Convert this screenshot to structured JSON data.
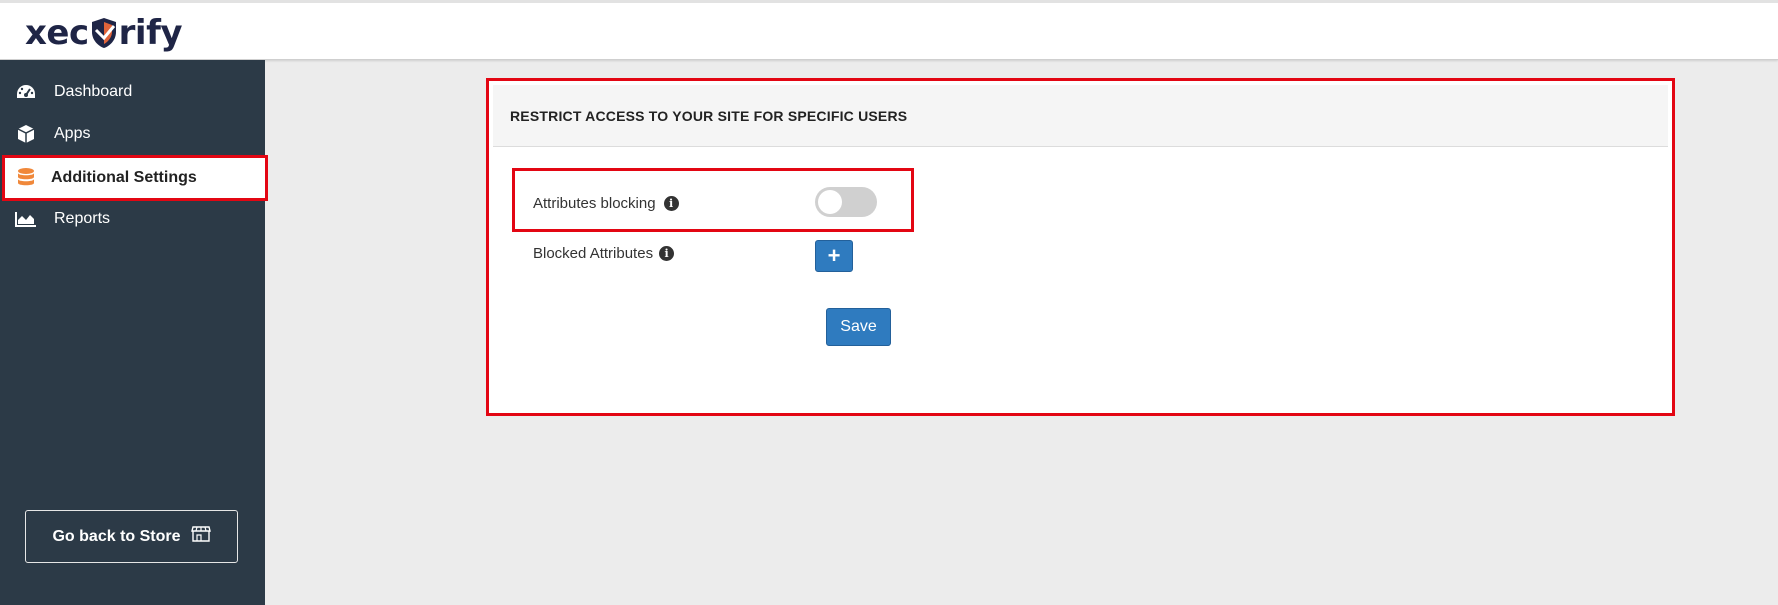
{
  "brand": {
    "logo_left": "xec",
    "logo_right": "rify"
  },
  "sidebar": {
    "items": [
      {
        "label": "Dashboard",
        "icon": "speedometer-icon"
      },
      {
        "label": "Apps",
        "icon": "cube-icon"
      },
      {
        "label": "Additional Settings",
        "icon": "database-icon",
        "active": true
      },
      {
        "label": "Reports",
        "icon": "area-chart-icon"
      }
    ],
    "store_button": "Go back to Store"
  },
  "panel": {
    "title": "RESTRICT ACCESS TO YOUR SITE FOR SPECIFIC USERS",
    "attributes_blocking_label": "Attributes blocking",
    "attributes_blocking_enabled": false,
    "blocked_attributes_label": "Blocked Attributes",
    "add_symbol": "+",
    "save_label": "Save"
  },
  "colors": {
    "sidebar_bg": "#2c3a47",
    "accent_blue": "#2f7bbf",
    "highlight_red": "#e30613",
    "db_icon_orange": "#f0883a"
  }
}
